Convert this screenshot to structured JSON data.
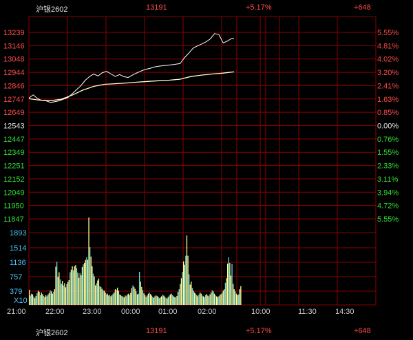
{
  "quote": {
    "symbol": "沪银2602",
    "price": "13191",
    "change_pct": "+5.17%",
    "change": "+648"
  },
  "colors": {
    "up": "#ff4a4a",
    "down": "#33dd33",
    "grid": "#8a0000",
    "price_line": "#ffffff",
    "avg_line": "#ffffcc",
    "volume_up": "#ffff99",
    "volume_down": "#66dddd",
    "vol_axis": "#4fc3f7"
  },
  "chart_data": {
    "type": "line",
    "x_ticks": [
      "21:00",
      "22:00",
      "23:00",
      "00:00",
      "01:00",
      "02:00",
      "10:00",
      "11:30",
      "14:30"
    ],
    "y_left_ticks": [
      "13239",
      "13146",
      "13048",
      "12944",
      "12846",
      "12747",
      "12649",
      "12543",
      "12447",
      "12349",
      "12251",
      "12152",
      "12049",
      "11950",
      "11847"
    ],
    "y_right_ticks": [
      "5.55%",
      "4.81%",
      "4.02%",
      "3.20%",
      "2.41%",
      "1.63%",
      "0.85%",
      "0.00%",
      "0.76%",
      "1.55%",
      "2.33%",
      "3.11%",
      "3.94%",
      "4.72%",
      "5.55%"
    ],
    "reference_price": 12543,
    "ylim": [
      11847,
      13239
    ],
    "series": [
      {
        "label": "price",
        "points": [
          [
            0,
            12749
          ],
          [
            4,
            12772
          ],
          [
            8,
            12745
          ],
          [
            12,
            12731
          ],
          [
            16,
            12728
          ],
          [
            20,
            12716
          ],
          [
            24,
            12721
          ],
          [
            28,
            12728
          ],
          [
            32,
            12741
          ],
          [
            36,
            12752
          ],
          [
            40,
            12780
          ],
          [
            44,
            12810
          ],
          [
            48,
            12840
          ],
          [
            52,
            12880
          ],
          [
            56,
            12908
          ],
          [
            60,
            12928
          ],
          [
            64,
            12914
          ],
          [
            68,
            12938
          ],
          [
            72,
            12948
          ],
          [
            76,
            12928
          ],
          [
            80,
            12910
          ],
          [
            84,
            12924
          ],
          [
            88,
            12908
          ],
          [
            92,
            12902
          ],
          [
            96,
            12921
          ],
          [
            100,
            12936
          ],
          [
            104,
            12951
          ],
          [
            108,
            12963
          ],
          [
            112,
            12970
          ],
          [
            116,
            12980
          ],
          [
            120,
            12986
          ],
          [
            124,
            12990
          ],
          [
            128,
            12993
          ],
          [
            132,
            12997
          ],
          [
            136,
            13001
          ],
          [
            140,
            13006
          ],
          [
            144,
            13049
          ],
          [
            148,
            13083
          ],
          [
            152,
            13120
          ],
          [
            156,
            13138
          ],
          [
            160,
            13152
          ],
          [
            164,
            13168
          ],
          [
            168,
            13190
          ],
          [
            172,
            13230
          ],
          [
            176,
            13222
          ],
          [
            180,
            13160
          ],
          [
            184,
            13175
          ],
          [
            188,
            13195
          ],
          [
            190,
            13191
          ]
        ]
      },
      {
        "label": "average",
        "points": [
          [
            0,
            12744
          ],
          [
            10,
            12733
          ],
          [
            20,
            12729
          ],
          [
            30,
            12740
          ],
          [
            40,
            12770
          ],
          [
            50,
            12808
          ],
          [
            60,
            12836
          ],
          [
            70,
            12851
          ],
          [
            80,
            12856
          ],
          [
            90,
            12861
          ],
          [
            100,
            12867
          ],
          [
            110,
            12873
          ],
          [
            120,
            12878
          ],
          [
            130,
            12882
          ],
          [
            140,
            12889
          ],
          [
            150,
            12909
          ],
          [
            160,
            12920
          ],
          [
            170,
            12928
          ],
          [
            180,
            12935
          ],
          [
            190,
            12944
          ]
        ]
      }
    ],
    "volume_ticks": [
      "1893",
      "1514",
      "1136",
      "757",
      "379"
    ],
    "volume_unit": "X10",
    "volume_ylim": [
      0,
      2330
    ],
    "volume": [
      400,
      250,
      300,
      280,
      220,
      180,
      240,
      310,
      380,
      350,
      260,
      330,
      290,
      240,
      210,
      260,
      230,
      280,
      320,
      390,
      360,
      300,
      350,
      420,
      1020,
      1150,
      750,
      870,
      680,
      560,
      640,
      520,
      580,
      470,
      550,
      610,
      660,
      870,
      940,
      1030,
      920,
      1030,
      1060,
      980,
      860,
      720,
      850,
      790,
      1010,
      1080,
      1120,
      1200,
      1270,
      1200,
      2330,
      1540,
      1290,
      1030,
      830,
      760,
      520,
      580,
      650,
      700,
      500,
      480,
      430,
      390,
      380,
      330,
      280,
      300,
      250,
      270,
      230,
      260,
      300,
      330,
      420,
      400,
      460,
      380,
      280,
      260,
      240,
      220,
      200,
      250,
      230,
      280,
      300,
      260,
      320,
      450,
      520,
      480,
      430,
      360,
      280,
      300,
      880,
      620,
      480,
      390,
      310,
      260,
      210,
      250,
      300,
      330,
      290,
      250,
      220,
      190,
      230,
      260,
      240,
      210,
      180,
      200,
      230,
      270,
      250,
      220,
      190,
      170,
      210,
      250,
      280,
      300,
      260,
      230,
      210,
      200,
      240,
      350,
      420,
      560,
      710,
      880,
      1160,
      1070,
      1310,
      1850,
      1310,
      820,
      540,
      620,
      450,
      380,
      330,
      300,
      260,
      230,
      280,
      330,
      300,
      250,
      230,
      210,
      260,
      290,
      250,
      230,
      280,
      330,
      390,
      360,
      300,
      260,
      230,
      210,
      230,
      260,
      290,
      320,
      380,
      420,
      590,
      710,
      1100,
      1270,
      1120,
      780,
      1090,
      560,
      420,
      360,
      300,
      260,
      280,
      420,
      500
    ]
  }
}
